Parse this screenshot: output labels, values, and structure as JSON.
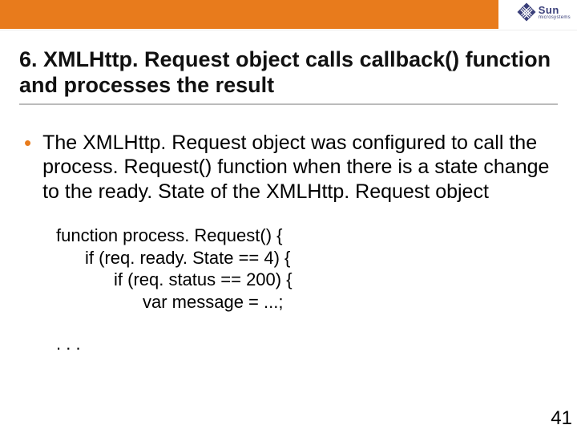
{
  "logo": {
    "brand": "Sun",
    "sub": "microsystems"
  },
  "title": "6. XMLHttp. Request object calls callback() function and processes the result",
  "bullet": "The XMLHttp. Request object was configured to call the process. Request() function when there is a state change to the ready. State of the XMLHttp. Request object",
  "code": {
    "l1": "function process. Request() {",
    "l2": "if (req. ready. State == 4) {",
    "l3": "if (req. status == 200) {",
    "l4": "var message = ...;"
  },
  "ellipsis": ". . .",
  "page": "41"
}
